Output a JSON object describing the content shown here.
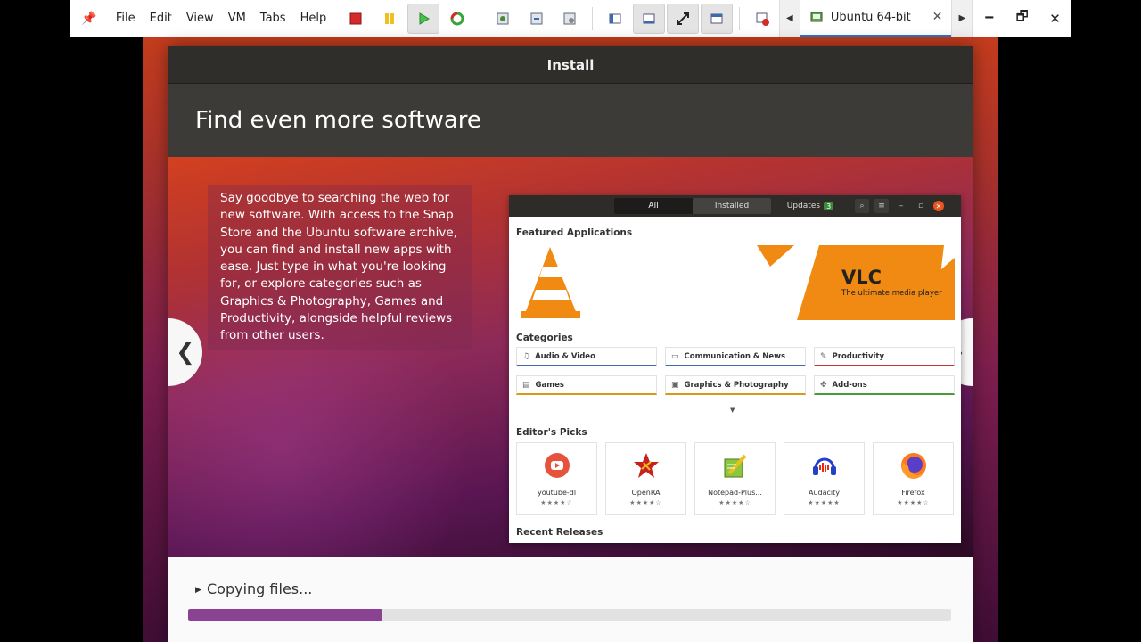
{
  "vm": {
    "menu": [
      "File",
      "Edit",
      "View",
      "VM",
      "Tabs",
      "Help"
    ],
    "tab_label": "Ubuntu 64-bit",
    "icons": [
      "pin-icon",
      "power-off-icon",
      "suspend-icon",
      "power-on-icon",
      "reset-icon",
      "snapshot-icon",
      "revert-snapshot-icon",
      "manage-snapshots-icon",
      "show-library-icon",
      "show-thumbnail-icon",
      "fullscreen-icon",
      "unity-icon",
      "close-vm-icon"
    ]
  },
  "installer": {
    "header_title": "Install",
    "slide_title": "Find even more software",
    "slide_text": "Say goodbye to searching the web for new software. With access to the Snap Store and the Ubuntu software archive, you can find and install new apps with ease. Just type in what you're looking for, or explore categories such as Graphics & Photography, Games and Productivity, alongside helpful reviews from other users.",
    "nav_prev": "❮",
    "nav_next": "❯",
    "status_text": "Copying files...",
    "progress_fraction": 0.255
  },
  "store": {
    "tabs": [
      "All",
      "Installed",
      "Updates"
    ],
    "updates_count": "3",
    "featured_heading": "Featured Applications",
    "banner_title": "VLC",
    "banner_subtitle": "The ultimate media player",
    "categories_heading": "Categories",
    "categories": [
      {
        "label": "Audio & Video",
        "color": "#3e6bb5"
      },
      {
        "label": "Communication & News",
        "color": "#3e6bb5"
      },
      {
        "label": "Productivity",
        "color": "#c7342b"
      },
      {
        "label": "Games",
        "color": "#d59a18"
      },
      {
        "label": "Graphics & Photography",
        "color": "#d59a18"
      },
      {
        "label": "Add-ons",
        "color": "#4a9a3a"
      }
    ],
    "picks_heading": "Editor's Picks",
    "picks": [
      {
        "name": "youtube-dl",
        "stars": "★★★★☆"
      },
      {
        "name": "OpenRA",
        "stars": "★★★★☆"
      },
      {
        "name": "Notepad-Plus...",
        "stars": "★★★★☆"
      },
      {
        "name": "Audacity",
        "stars": "★★★★★"
      },
      {
        "name": "Firefox",
        "stars": "★★★★☆"
      }
    ],
    "recent_heading": "Recent Releases"
  }
}
